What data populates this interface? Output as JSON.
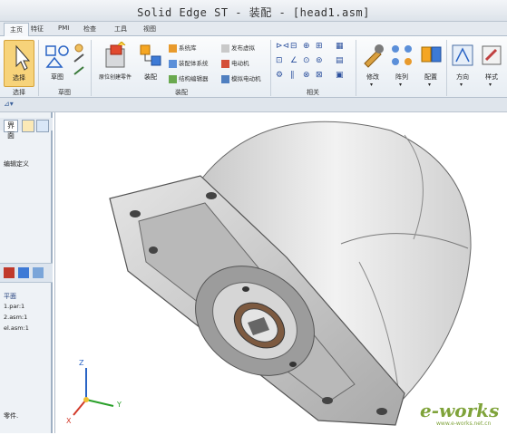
{
  "window": {
    "title": "Solid Edge ST - 装配 - [head1.asm]"
  },
  "tabs": [
    {
      "label": "主页"
    },
    {
      "label": "特征"
    },
    {
      "label": "PMI"
    },
    {
      "label": "检查"
    },
    {
      "label": "工具"
    },
    {
      "label": "视图"
    }
  ],
  "ribbon": {
    "select_group": {
      "button_label": "选择",
      "group_label": "选择"
    },
    "plane_group": {
      "button_label": "草图",
      "group_label": "草图"
    },
    "assemble_group": {
      "group_label": "装配",
      "place_part_label": "原位创建零件",
      "assemble_label": "装配",
      "items": [
        "系统库",
        "装配体系统",
        "结构编辑器",
        "发布虚拟",
        "电动机",
        "模拟电动机"
      ]
    },
    "relate_group": {
      "group_label": "相关"
    },
    "modify": {
      "label": "修改"
    },
    "pattern": {
      "label": "阵列"
    },
    "config": {
      "label": "配置"
    },
    "orient": {
      "label": "方向"
    },
    "style": {
      "label": "样式"
    }
  },
  "left_panel": {
    "tab_label": "界面",
    "item_label": "编辑定义",
    "tree_header": "平面",
    "tree_items": [
      "1.par:1",
      "2.asm:1",
      "el.asm:1"
    ],
    "status_text": "零件."
  },
  "viewport": {
    "axis_x": "X",
    "axis_y": "Y",
    "axis_z": "Z",
    "watermark": "e-works",
    "watermark_url": "www.e-works.net.cn"
  }
}
